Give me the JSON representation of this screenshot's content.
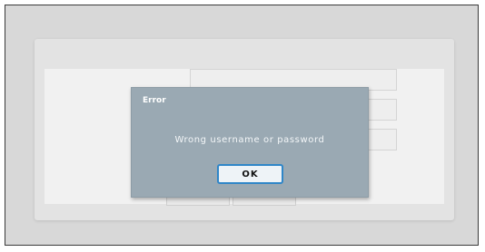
{
  "dialog": {
    "title": "Error",
    "message": "Wrong username or password",
    "ok_label": "OK"
  },
  "colors": {
    "background": "#d8d8d8",
    "dialog_background": "#9aa9b3",
    "button_border": "#2f86c8"
  }
}
